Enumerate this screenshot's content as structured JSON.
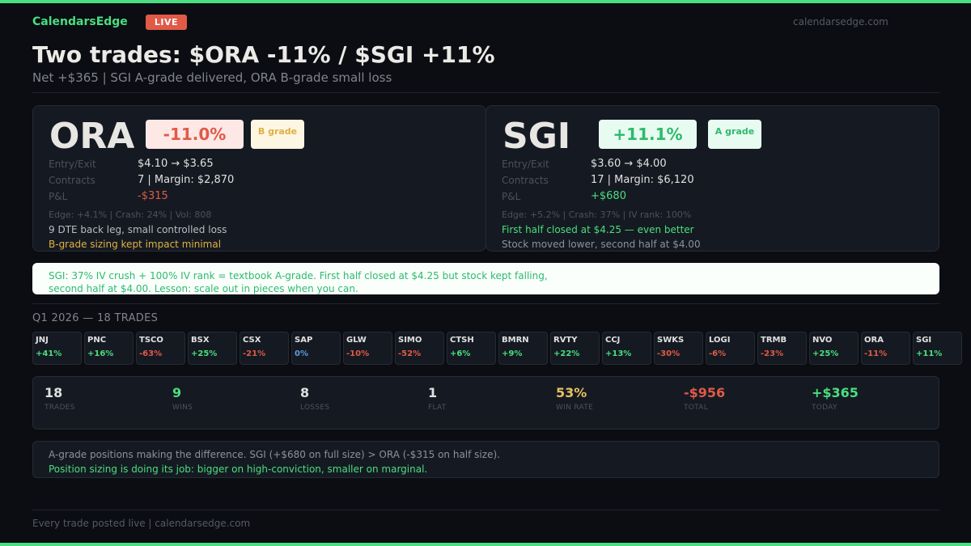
{
  "header": {
    "brand": "CalendarsEdge",
    "live_badge": "LIVE",
    "site": "calendarsedge.com",
    "title": "Two trades: $ORA -11% / $SGI +11%",
    "subtitle": "Net +$365  |  SGI A-grade delivered, ORA B-grade small loss"
  },
  "cards": [
    {
      "ticker": "ORA",
      "pct": "-11.0%",
      "grade": "B grade",
      "entry_exit_label": "Entry/Exit",
      "entry_exit": "$4.10 → $3.65",
      "contracts_label": "Contracts",
      "contracts": "7  |  Margin: $2,870",
      "pnl_label": "P&L",
      "pnl": "-$315",
      "meta": "Edge: +4.1%  |  Crash: 24%  |  Vol: 808",
      "note1": "9 DTE back leg, small controlled loss",
      "note2": "B-grade sizing kept impact minimal"
    },
    {
      "ticker": "SGI",
      "pct": "+11.1%",
      "grade": "A grade",
      "entry_exit_label": "Entry/Exit",
      "entry_exit": "$3.60 → $4.00",
      "contracts_label": "Contracts",
      "contracts": "17  |  Margin: $6,120",
      "pnl_label": "P&L",
      "pnl": "+$680",
      "meta": "Edge: +5.2%  |  Crash: 37%  |  IV rank: 100%",
      "note1": "First half closed at $4.25 — even better",
      "note2": "Stock moved lower, second half at $4.00"
    }
  ],
  "callout": {
    "line1": "SGI: 37% IV crush + 100% IV rank = textbook A-grade. First half closed at $4.25 but stock kept falling,",
    "line2": "second half at $4.00. Lesson: scale out in pieces when you can."
  },
  "quarter": {
    "label": "Q1 2026 — 18 TRADES",
    "trades": [
      {
        "ticker": "JNJ",
        "pct": "+41%"
      },
      {
        "ticker": "PNC",
        "pct": "+16%"
      },
      {
        "ticker": "TSCO",
        "pct": "-63%"
      },
      {
        "ticker": "BSX",
        "pct": "+25%"
      },
      {
        "ticker": "CSX",
        "pct": "-21%"
      },
      {
        "ticker": "SAP",
        "pct": "0%"
      },
      {
        "ticker": "GLW",
        "pct": "-10%"
      },
      {
        "ticker": "SIMO",
        "pct": "-52%"
      },
      {
        "ticker": "CTSH",
        "pct": "+6%"
      },
      {
        "ticker": "BMRN",
        "pct": "+9%"
      },
      {
        "ticker": "RVTY",
        "pct": "+22%"
      },
      {
        "ticker": "CCJ",
        "pct": "+13%"
      },
      {
        "ticker": "SWKS",
        "pct": "-30%"
      },
      {
        "ticker": "LOGI",
        "pct": "-6%"
      },
      {
        "ticker": "TRMB",
        "pct": "-23%"
      },
      {
        "ticker": "NVO",
        "pct": "+25%"
      },
      {
        "ticker": "ORA",
        "pct": "-11%"
      },
      {
        "ticker": "SGI",
        "pct": "+11%"
      }
    ]
  },
  "stats": [
    {
      "value": "18",
      "label": "TRADES",
      "color": "#e0e0e0"
    },
    {
      "value": "9",
      "label": "WINS",
      "color": "#4ade80"
    },
    {
      "value": "8",
      "label": "LOSSES",
      "color": "#e0e0e0"
    },
    {
      "value": "1",
      "label": "FLAT",
      "color": "#e0e0e0"
    },
    {
      "value": "53%",
      "label": "WIN RATE",
      "color": "#e8c060"
    },
    {
      "value": "-$956",
      "label": "TOTAL",
      "color": "#e05a47"
    },
    {
      "value": "+$365",
      "label": "TODAY",
      "color": "#4ade80"
    }
  ],
  "summary": {
    "line1": "A-grade positions making the difference. SGI (+$680 on full size) > ORA (-$315 on half size).",
    "line2": "Position sizing is doing its job: bigger on high-conviction, smaller on marginal."
  },
  "footer": "Every trade posted live  |  calendarsedge.com",
  "colors": {
    "accent_green": "#4ade80",
    "loss_red": "#e05a47",
    "grade_yellow": "#e0b040",
    "flat_blue": "#5b9be0"
  }
}
